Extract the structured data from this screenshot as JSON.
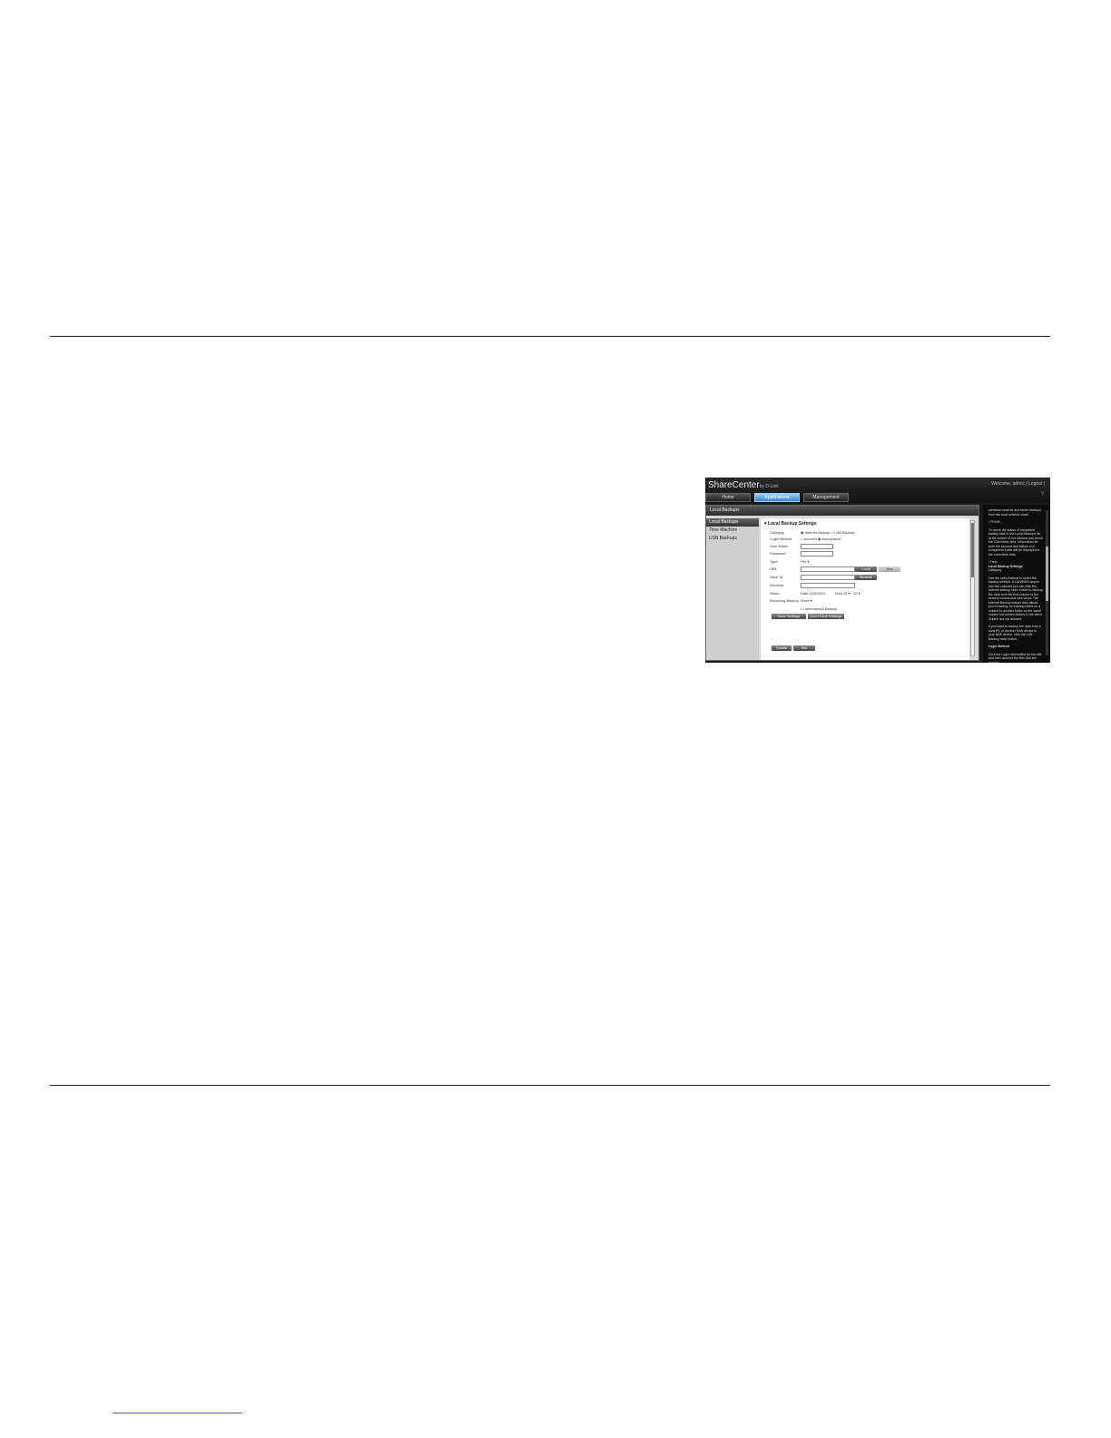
{
  "app": {
    "logo": "ShareCenter",
    "logo_sub": "by D-Link",
    "welcome": "Welcome, admic | Logout | ",
    "help_icon": "?",
    "tabs": [
      {
        "label": "Home"
      },
      {
        "label": "Applications"
      },
      {
        "label": "Management"
      }
    ]
  },
  "panel": {
    "title": "Local Backups",
    "sidebar": [
      {
        "label": "Local Backups"
      },
      {
        "label": "Time Machine"
      },
      {
        "label": "USB Backups"
      }
    ],
    "section_title": "Local Backup Settings",
    "form": {
      "category_label": "Category",
      "category_opt1": "Internet Backup",
      "category_opt2": "LAN Backup",
      "login_label": "Login Method",
      "login_opt1": "Account",
      "login_opt2": "Anonymous",
      "username_label": "User Name",
      "password_label": "Password",
      "type_label": "Type",
      "type_value": "File",
      "url_label": "URL",
      "saveto_label": "Save To",
      "rename_label": "Rename",
      "when_label": "When",
      "date_label": "Date",
      "date_value": "2/25/2012",
      "time_label": "Time",
      "time_h": "21",
      "time_m": "10",
      "recurring_label": "Recurring Backup",
      "recurring_value": "None",
      "incremental_label": "Incremental Backup",
      "btn_local": "Local",
      "btn_test": "Test",
      "btn_browse": "Browse",
      "btn_save": "Save Settings",
      "btn_dont_save": "Don't Save Settings",
      "btn_create": "Create",
      "btn_del": "Del"
    }
  },
  "help": {
    "p1": "schedule must be and faster backups from the local network share.",
    "h2": "FROM",
    "p2": "To check the status of completed backup task in the Local Backups list at the bottom of the window and check the Comments field. Information for both the success and failure of a completion bullet will be displayed in the comments field.",
    "h3": "Help",
    "h3b": "Local Backup Settings",
    "h3c": "Category",
    "p3": "Use the radio buttons to select the backup method. If LAN/WAN device has two volumes you can click the Internet backup radio button to backup the data from the first volume to the second volume and vice versa. The Internet Backup feature also allows you to backup an existing folder on a volume to another folder on the same volume but nested folders in the same volume are not allowed.",
    "p4": "If you want to backup the data from a local PC or another NAS device to your NAS device, click the LAN Backup radio button.",
    "h5": "Login Method",
    "p5": "Click the Login information for the site and then account the files that are used to"
  }
}
